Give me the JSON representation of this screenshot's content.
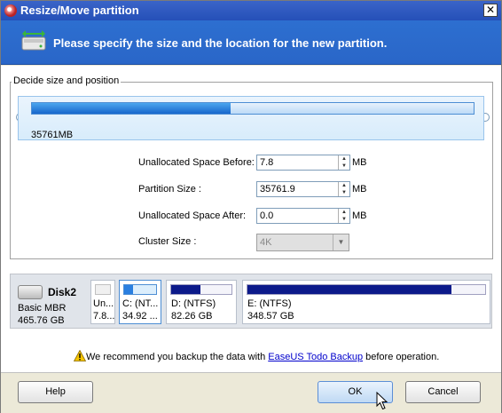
{
  "window": {
    "title": "Resize/Move partition",
    "close_label": "✕"
  },
  "banner": {
    "text": "Please specify the size and the location for the new partition."
  },
  "group": {
    "label": "Decide size and position"
  },
  "slider": {
    "size_label": "35761MB",
    "fill_fraction": 0.45
  },
  "form": {
    "unalloc_before": {
      "label": "Unallocated Space Before:",
      "value": "7.8",
      "unit": "MB"
    },
    "partition_size": {
      "label": "Partition Size :",
      "value": "35761.9",
      "unit": "MB"
    },
    "unalloc_after": {
      "label": "Unallocated Space After:",
      "value": "0.0",
      "unit": "MB"
    },
    "cluster_size": {
      "label": "Cluster Size :",
      "value": "4K"
    }
  },
  "disk": {
    "name": "Disk2",
    "type": "Basic MBR",
    "capacity": "465.76 GB",
    "partitions": [
      {
        "name": "Un...",
        "size": "7.8..."
      },
      {
        "name": "C: (NT...",
        "size": "34.92 ..."
      },
      {
        "name": "D: (NTFS)",
        "size": "82.26 GB"
      },
      {
        "name": "E: (NTFS)",
        "size": "348.57 GB"
      }
    ]
  },
  "warning": {
    "prefix": "We recommend you backup the data with ",
    "link": "EaseUS Todo Backup",
    "suffix": " before operation."
  },
  "buttons": {
    "help": "Help",
    "ok": "OK",
    "cancel": "Cancel"
  },
  "colors": {
    "banner": "#2d6fd0",
    "fill": "#1766cc",
    "dark_partition": "#0c1a8a"
  }
}
